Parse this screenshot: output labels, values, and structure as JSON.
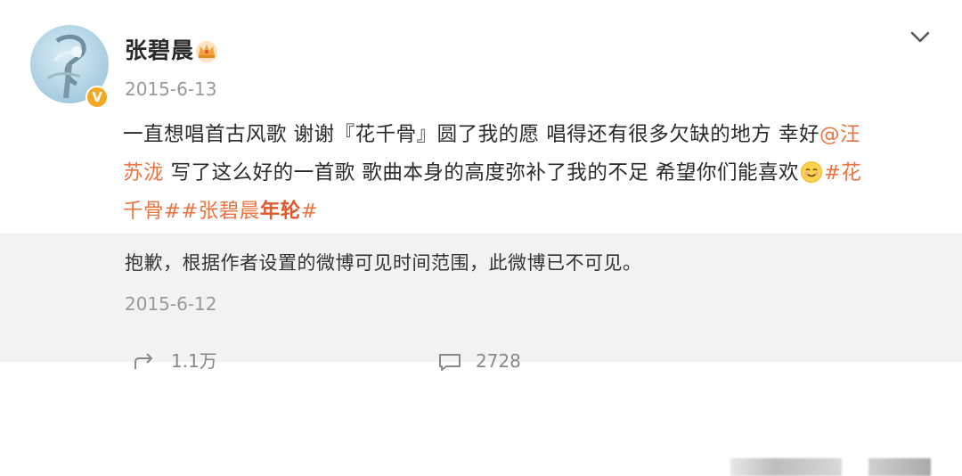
{
  "author": {
    "name": "张碧晨",
    "post_time": "2015-6-13",
    "verified_badge": "V"
  },
  "post": {
    "line1_text": "一直想唱首古风歌 谢谢『花千骨』圆了我的愿 唱得还有很多欠缺的地方 幸好",
    "line1_mention": "@汪",
    "line2_mention": "苏泷",
    "line2_text": " 写了这么好的一首歌 歌曲本身的高度弥补了我的不足 希望你们能喜欢",
    "line2_hashtag": "#花",
    "line3_hashtag1": "千骨#",
    "line3_hashtag2_start": "#张碧晨",
    "line3_hashtag2_strong": "年轮",
    "line3_hashtag2_end": "#",
    "emoji": "smile-icon"
  },
  "repost": {
    "notice": "抱歉，根据作者设置的微博可见时间范围，此微博已不可见。",
    "time": "2015-6-12"
  },
  "actions": {
    "share_count": "1.1万",
    "comment_count": "2728"
  },
  "colors": {
    "link": "#eb7340",
    "badge": "#f5a623",
    "muted": "#999999",
    "repost_bg": "#f2f2f2"
  }
}
